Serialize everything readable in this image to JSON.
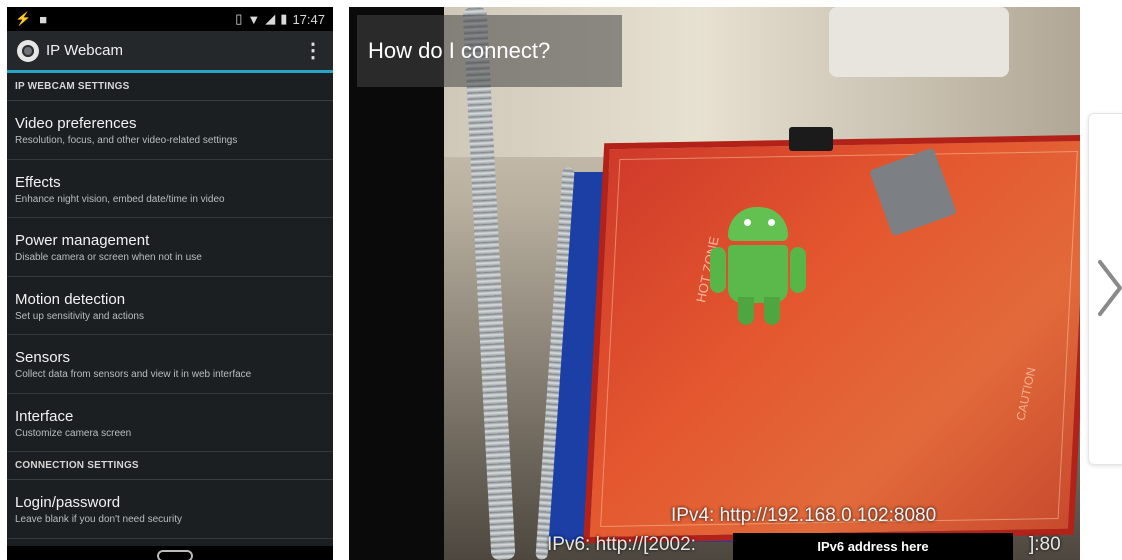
{
  "phone": {
    "status_time": "17:47",
    "app_title": "IP Webcam",
    "sections": [
      {
        "label": "IP WEBCAM SETTINGS"
      },
      {
        "label": "CONNECTION SETTINGS"
      }
    ],
    "preferences": [
      {
        "title": "Video preferences",
        "subtitle": "Resolution, focus, and other video-related settings"
      },
      {
        "title": "Effects",
        "subtitle": "Enhance night vision, embed date/time in video"
      },
      {
        "title": "Power management",
        "subtitle": "Disable camera or screen when not in use"
      },
      {
        "title": "Motion detection",
        "subtitle": "Set up sensitivity and actions"
      },
      {
        "title": "Sensors",
        "subtitle": "Collect data from sensors and view it in web interface"
      },
      {
        "title": "Interface",
        "subtitle": "Customize camera screen"
      },
      {
        "title": "Login/password",
        "subtitle": "Leave blank if you don't need security"
      }
    ],
    "accent_color": "#2aa3c9"
  },
  "camera": {
    "connect_title": "How do I connect?",
    "ipv4_text": "IPv4: http://192.168.0.102:8080",
    "ipv6_prefix": "IPv6: http://[2002:",
    "ipv6_box": "IPv6 address here",
    "ipv6_suffix": "]:80",
    "bed_text_1": "HOT ZONE",
    "bed_text_2": "CAUTION"
  },
  "icons": {
    "next": "chevron-right-icon",
    "menu": "overflow-menu-icon"
  }
}
